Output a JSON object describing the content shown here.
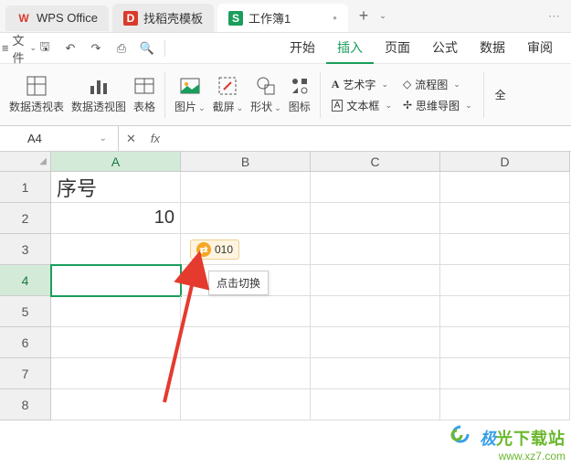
{
  "tabs": {
    "app": "WPS Office",
    "template": "找稻壳模板",
    "workbook": "工作簿1",
    "close_glyph": "•"
  },
  "menubar": {
    "file": "文件",
    "items": [
      "开始",
      "插入",
      "页面",
      "公式",
      "数据",
      "审阅"
    ],
    "active_index": 1
  },
  "ribbon": {
    "pivot_table": "数据透视表",
    "pivot_chart": "数据透视图",
    "table": "表格",
    "picture": "图片",
    "screenshot": "截屏",
    "shapes": "形状",
    "icon": "图标",
    "wordart": "艺术字",
    "textbox": "文本框",
    "flowchart": "流程图",
    "mindmap": "思维导图",
    "all": "全"
  },
  "formula_bar": {
    "name_box": "A4",
    "fx": "fx",
    "cancel": "✕",
    "value": ""
  },
  "sheet": {
    "columns": [
      "A",
      "B",
      "C",
      "D"
    ],
    "rows": [
      "1",
      "2",
      "3",
      "4",
      "5",
      "6",
      "7",
      "8"
    ],
    "cells": {
      "A1": "序号",
      "A2": "10"
    },
    "selected": "A4"
  },
  "smart_tag": {
    "icon_glyph": "⇄",
    "value": "010",
    "tooltip": "点击切换"
  },
  "watermark": {
    "brand_first": "极",
    "brand_rest": "光下载站",
    "url": "www.xz7.com"
  }
}
